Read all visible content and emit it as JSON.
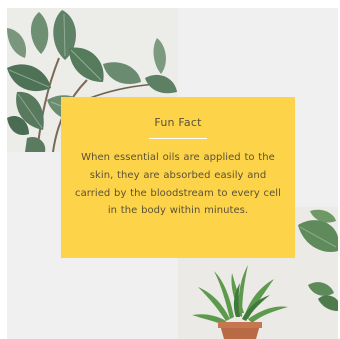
{
  "fun_fact": {
    "title": "Fun Fact",
    "body": "When essential oils are applied to the skin, they are absorbed easily and carried by the bloodstream to every cell in the body within minutes."
  },
  "colors": {
    "background": "#f0f0f1",
    "fact_box": "#fcd349",
    "fact_text": "#5b5237",
    "divider": "#ffffff"
  }
}
